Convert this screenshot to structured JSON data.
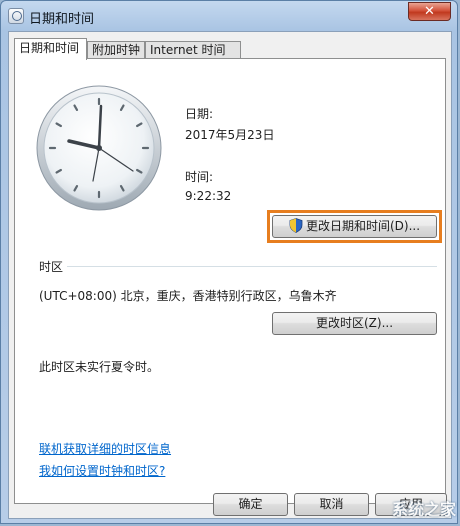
{
  "window": {
    "title": "日期和时间",
    "close_glyph": "✕"
  },
  "tabs": [
    {
      "label": "日期和时间",
      "active": true
    },
    {
      "label": "附加时钟",
      "active": false
    },
    {
      "label": "Internet 时间",
      "active": false
    }
  ],
  "date_section": {
    "date_label": "日期:",
    "date_value": "2017年5月23日",
    "time_label": "时间:",
    "time_value": "9:22:32",
    "change_button": "更改日期和时间(D)..."
  },
  "timezone": {
    "heading": "时区",
    "value": "(UTC+08:00) 北京，重庆，香港特别行政区，乌鲁木齐",
    "change_button": "更改时区(Z)...",
    "dst_note": "此时区未实行夏令时。"
  },
  "links": {
    "online_info": "联机获取详细的时区信息",
    "how_to": "我如何设置时钟和时区?"
  },
  "footer": {
    "ok": "确定",
    "cancel": "取消",
    "apply": "应用"
  },
  "watermark": {
    "text": "系统之家"
  },
  "colors": {
    "highlight": "#e77e1f",
    "link": "#0066cc"
  }
}
